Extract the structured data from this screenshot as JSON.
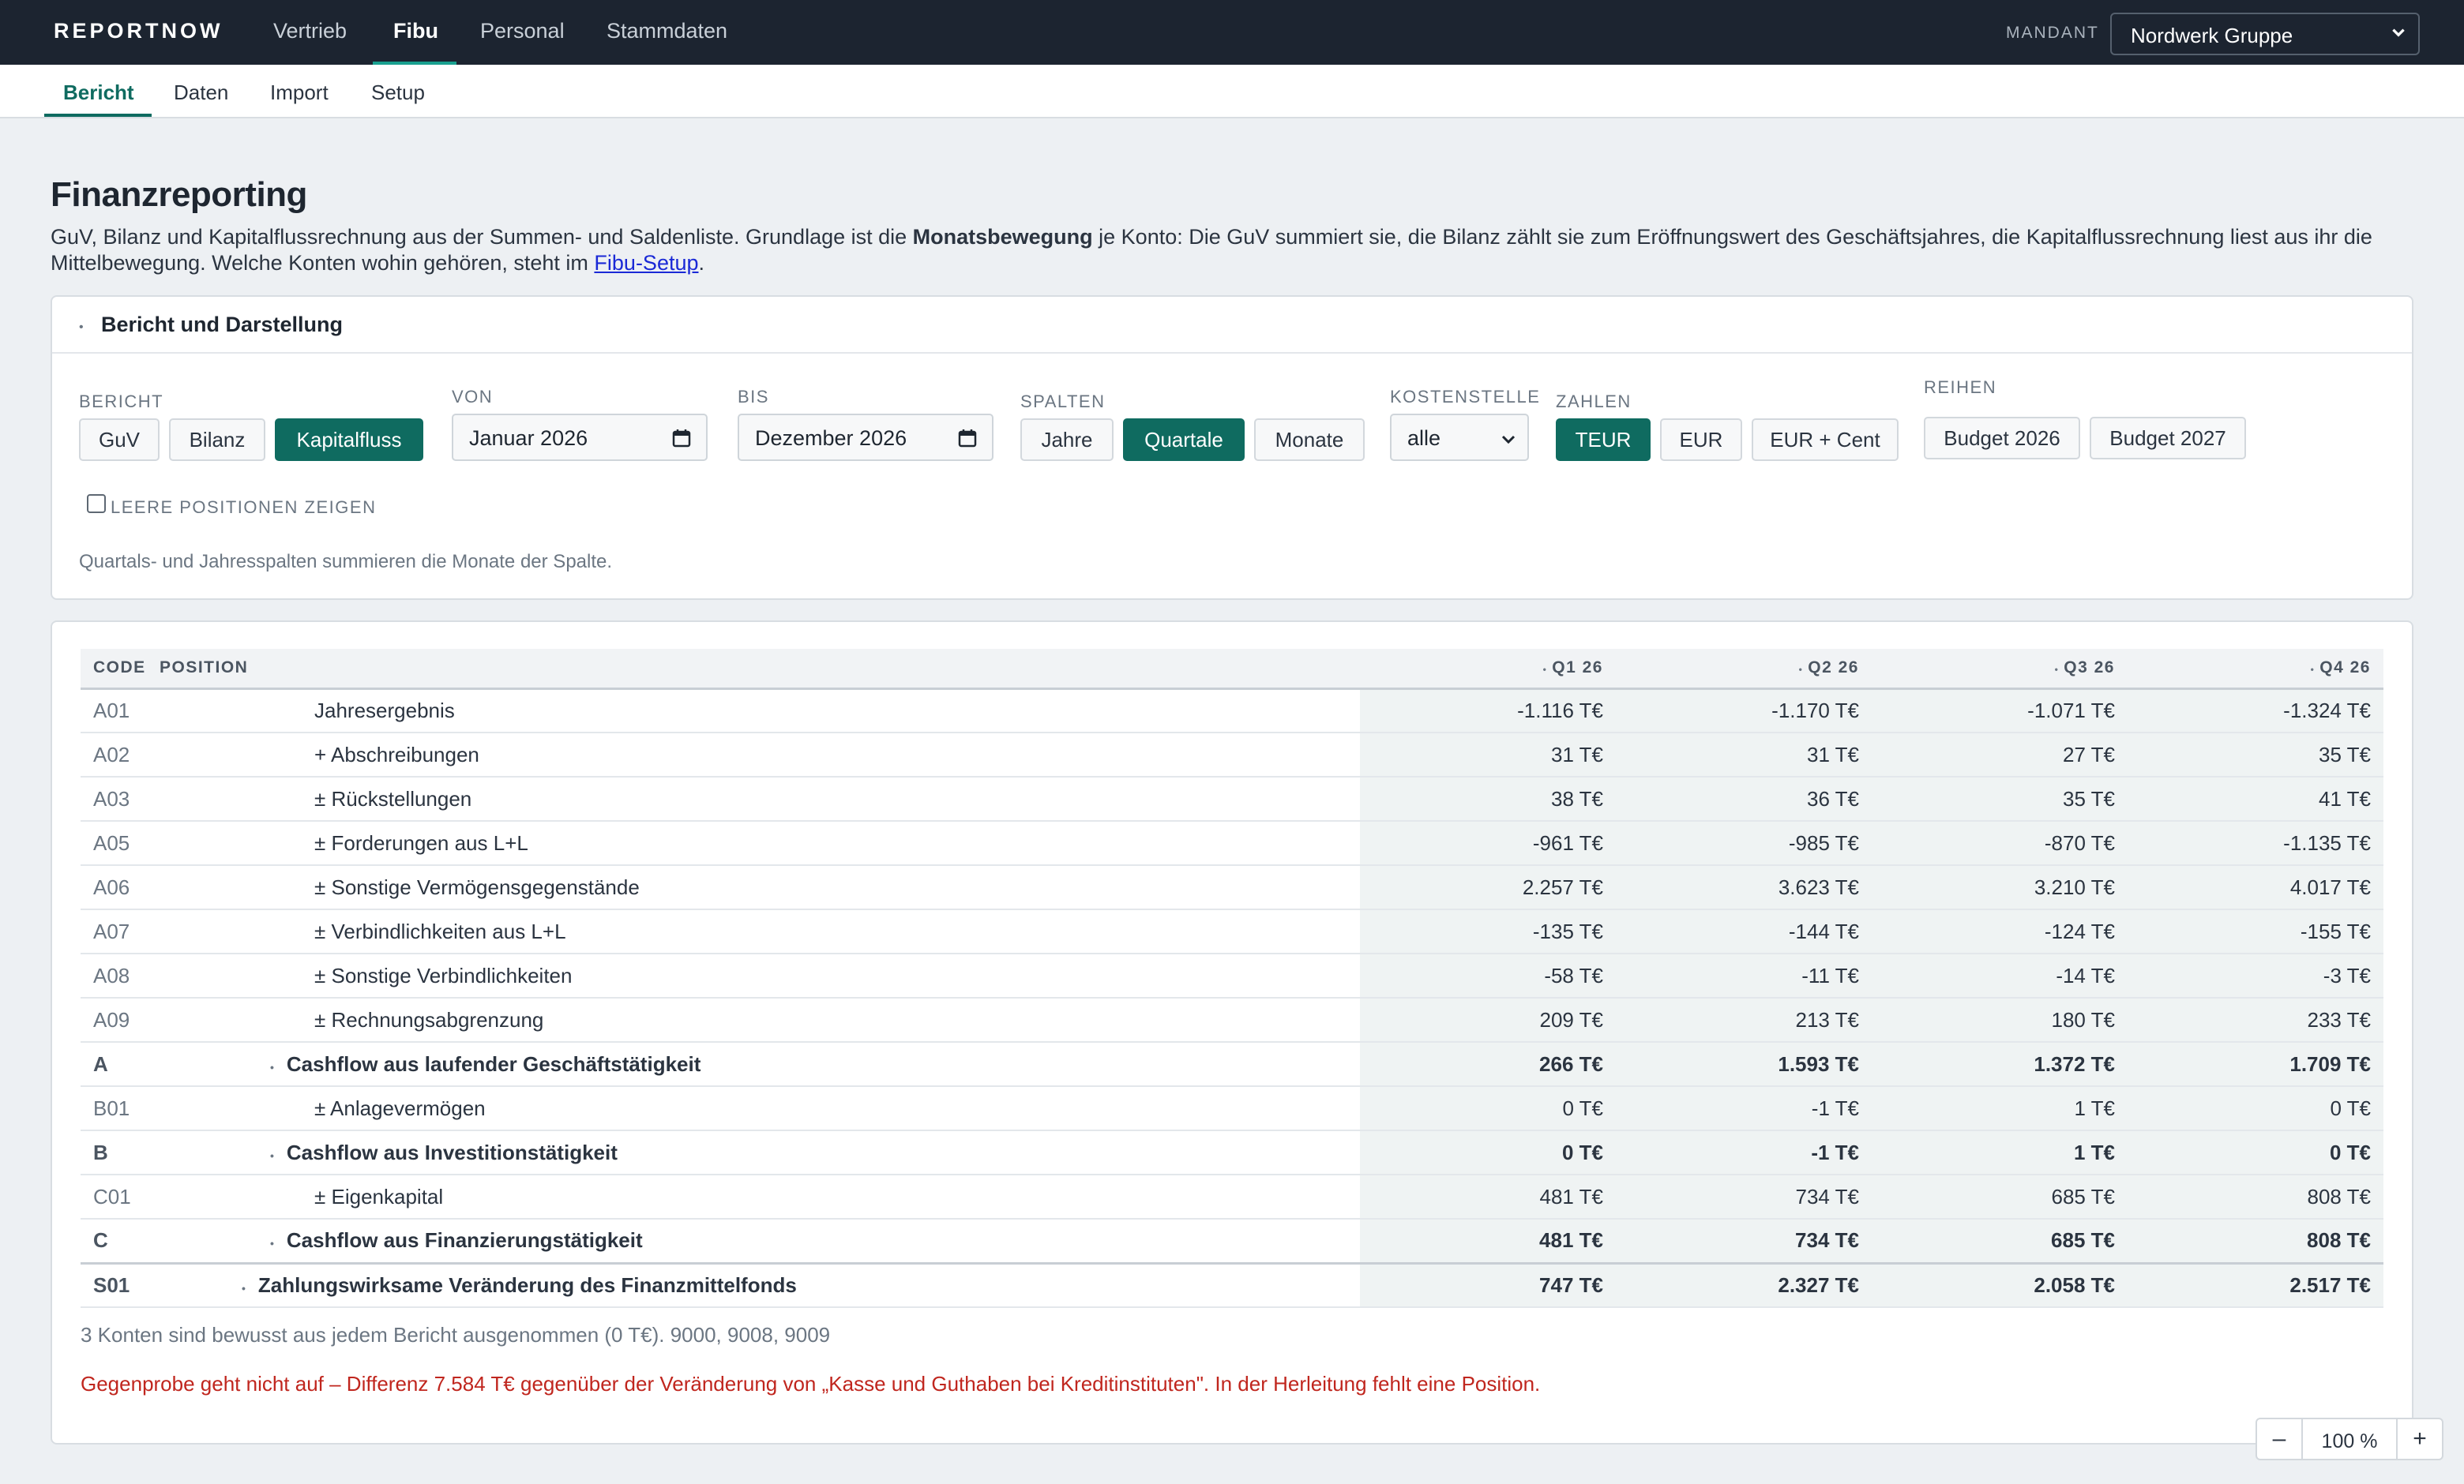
{
  "app": {
    "brand": "REPORTNOW"
  },
  "topnav": {
    "items": [
      {
        "label": "Vertrieb"
      },
      {
        "label": "Fibu",
        "active": true
      },
      {
        "label": "Personal"
      },
      {
        "label": "Stammdaten"
      }
    ],
    "mandant_label": "MANDANT",
    "mandant_value": "Nordwerk Gruppe"
  },
  "subnav": {
    "items": [
      {
        "label": "Bericht",
        "active": true
      },
      {
        "label": "Daten"
      },
      {
        "label": "Import"
      },
      {
        "label": "Setup"
      }
    ]
  },
  "page": {
    "title": "Finanzreporting",
    "intro_1": "GuV, Bilanz und Kapitalflussrechnung aus der Summen- und Saldenliste. Grundlage ist die ",
    "intro_bold": "Monatsbewegung",
    "intro_2": " je Konto: Die GuV summiert sie, die Bilanz zählt sie zum Eröffnungswert des Geschäftsjahres, die Kapitalflussrechnung liest aus ihr die Mittelbewegung. Welche Konten wohin gehören, steht im ",
    "intro_link": "Fibu-Setup",
    "intro_end": "."
  },
  "settings": {
    "header": "Bericht und Darstellung",
    "bericht_label": "BERICHT",
    "bericht_options": [
      "GuV",
      "Bilanz",
      "Kapitalfluss"
    ],
    "bericht_selected": "Kapitalfluss",
    "von_label": "VON",
    "von_value": "Januar  2026",
    "bis_label": "BIS",
    "bis_value": "Dezember  2026",
    "spalten_label": "SPALTEN",
    "spalten_options": [
      "Jahre",
      "Quartale",
      "Monate"
    ],
    "spalten_selected": "Quartale",
    "kostenstelle_label": "KOSTENSTELLE",
    "kostenstelle_value": "alle",
    "zahlen_label": "ZAHLEN",
    "zahlen_options": [
      "TEUR",
      "EUR",
      "EUR + Cent"
    ],
    "zahlen_selected": "TEUR",
    "reihen_label": "REIHEN",
    "reihen_options": [
      "Budget 2026",
      "Budget 2027"
    ],
    "leere_label": "LEERE POSITIONEN ZEIGEN",
    "leere_checked": false,
    "hint": "Quartals- und Jahresspalten summieren die Monate der Spalte."
  },
  "table": {
    "headers": {
      "code": "CODE",
      "position": "POSITION",
      "q1": "Q1 26",
      "q2": "Q2 26",
      "q3": "Q3 26",
      "q4": "Q4 26"
    },
    "rows": [
      {
        "code": "A01",
        "position": "Jahresergebnis",
        "q1": "-1.116 T€",
        "q2": "-1.170 T€",
        "q3": "-1.071 T€",
        "q4": "-1.324 T€"
      },
      {
        "code": "A02",
        "position": "+ Abschreibungen",
        "q1": "31 T€",
        "q2": "31 T€",
        "q3": "27 T€",
        "q4": "35 T€"
      },
      {
        "code": "A03",
        "position": "± Rückstellungen",
        "q1": "38 T€",
        "q2": "36 T€",
        "q3": "35 T€",
        "q4": "41 T€"
      },
      {
        "code": "A05",
        "position": "± Forderungen aus L+L",
        "q1": "-961 T€",
        "q2": "-985 T€",
        "q3": "-870 T€",
        "q4": "-1.135 T€"
      },
      {
        "code": "A06",
        "position": "± Sonstige Vermögensgegenstände",
        "q1": "2.257 T€",
        "q2": "3.623 T€",
        "q3": "3.210 T€",
        "q4": "4.017 T€"
      },
      {
        "code": "A07",
        "position": "± Verbindlichkeiten aus L+L",
        "q1": "-135 T€",
        "q2": "-144 T€",
        "q3": "-124 T€",
        "q4": "-155 T€"
      },
      {
        "code": "A08",
        "position": "± Sonstige Verbindlichkeiten",
        "q1": "-58 T€",
        "q2": "-11 T€",
        "q3": "-14 T€",
        "q4": "-3 T€"
      },
      {
        "code": "A09",
        "position": "± Rechnungsabgrenzung",
        "q1": "209 T€",
        "q2": "213 T€",
        "q3": "180 T€",
        "q4": "233 T€"
      },
      {
        "code": "A",
        "position": "Cashflow aus laufender Geschäftstätigkeit",
        "q1": "266 T€",
        "q2": "1.593 T€",
        "q3": "1.372 T€",
        "q4": "1.709 T€"
      },
      {
        "code": "B01",
        "position": "± Anlagevermögen",
        "q1": "0 T€",
        "q2": "-1 T€",
        "q3": "1 T€",
        "q4": "0 T€"
      },
      {
        "code": "B",
        "position": "Cashflow aus Investitionstätigkeit",
        "q1": "0 T€",
        "q2": "-1 T€",
        "q3": "1 T€",
        "q4": "0 T€"
      },
      {
        "code": "C01",
        "position": "± Eigenkapital",
        "q1": "481 T€",
        "q2": "734 T€",
        "q3": "685 T€",
        "q4": "808 T€"
      },
      {
        "code": "C",
        "position": "Cashflow aus Finanzierungstätigkeit",
        "q1": "481 T€",
        "q2": "734 T€",
        "q3": "685 T€",
        "q4": "808 T€"
      },
      {
        "code": "S01",
        "position": "Zahlungswirksame Veränderung des Finanzmittelfonds",
        "q1": "747 T€",
        "q2": "2.327 T€",
        "q3": "2.058 T€",
        "q4": "2.517 T€"
      }
    ],
    "footnote": "3 Konten sind bewusst aus jedem Bericht ausgenommen (0 T€). 9000, 9008, 9009",
    "warning": "Gegenprobe geht nicht auf – Differenz 7.584 T€ gegenüber der Veränderung von „Kasse und Guthaben bei Kreditinstituten\". In der Herleitung fehlt eine Position."
  },
  "zoom": {
    "minus": "–",
    "value": "100 %",
    "plus": "+"
  },
  "colors": {
    "topbar": "#1c2430",
    "accent": "#0f6b60",
    "warning": "#c0261e",
    "link": "#1a29d6"
  }
}
